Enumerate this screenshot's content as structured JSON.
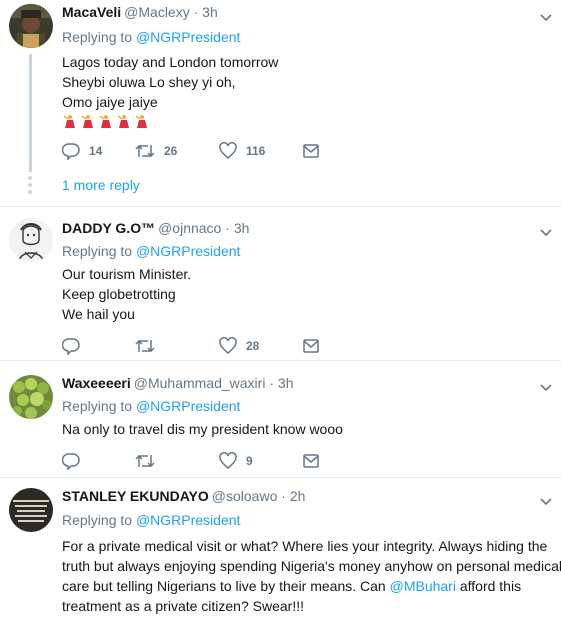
{
  "replying_prefix": "Replying to",
  "tweets": [
    {
      "name": "MacaVeli",
      "handle": "@Maclexy",
      "time": "3h",
      "replying_to": "@NGRPresident",
      "lines": [
        "Lagos today and London tomorrow",
        "Sheybi oluwa Lo shey yi oh,",
        "Omo jaiye jaiye"
      ],
      "emoji": [
        "dancer-emoji",
        "dancer-emoji",
        "dancer-emoji",
        "dancer-emoji",
        "dancer-emoji"
      ],
      "replies": "14",
      "retweets": "26",
      "likes": "116",
      "more_reply": "1 more reply"
    },
    {
      "name": "DADDY G.O™",
      "handle": "@ojnnaco",
      "time": "3h",
      "replying_to": "@NGRPresident",
      "lines": [
        "Our tourism Minister.",
        "Keep globetrotting",
        "We hail you"
      ],
      "replies": "",
      "retweets": "",
      "likes": "28"
    },
    {
      "name": "Waxeeeeri",
      "handle": "@Muhammad_waxiri",
      "time": "3h",
      "replying_to": "@NGRPresident",
      "lines": [
        "Na only to travel dis my president know wooo"
      ],
      "replies": "",
      "retweets": "",
      "likes": "9"
    },
    {
      "name": "STANLEY EKUNDAYO",
      "handle": "@soloawo",
      "time": "2h",
      "replying_to": "@NGRPresident",
      "lines": [
        "For a private medical visit or what? Where lies your integrity. Always hiding the",
        "truth but always enjoying spending Nigeria's money anyhow on personal medical",
        "care but telling Nigerians to live by their means. Can ",
        " afford this",
        "treatment as a private citizen? Swear!!!"
      ],
      "mention": "@MBuhari"
    }
  ],
  "colors": {
    "accent": "#1da1f2",
    "muted": "#657786",
    "text": "#14171a",
    "border": "#e6ecf0",
    "thread": "#ccd6dd"
  },
  "icons": {
    "reply": "reply-icon",
    "retweet": "retweet-icon",
    "like": "heart-icon",
    "dm": "envelope-icon",
    "caret": "chevron-down-icon"
  }
}
